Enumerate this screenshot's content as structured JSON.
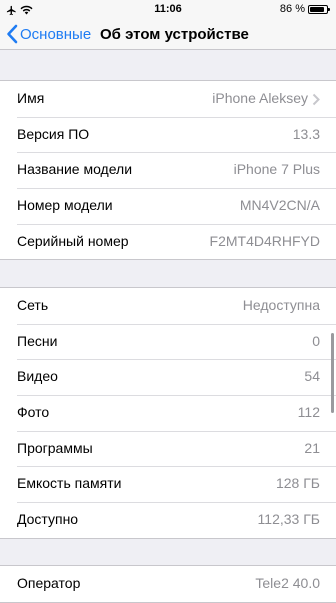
{
  "status_bar": {
    "time": "11:06",
    "battery_text": "86 %",
    "battery_level": 0.86
  },
  "nav": {
    "back_label": "Основные",
    "title": "Об этом устройстве"
  },
  "group1": [
    {
      "label": "Имя",
      "value": "iPhone Aleksey",
      "chevron": true
    },
    {
      "label": "Версия ПО",
      "value": "13.3"
    },
    {
      "label": "Название модели",
      "value": "iPhone 7 Plus"
    },
    {
      "label": "Номер модели",
      "value": "MN4V2CN/A"
    },
    {
      "label": "Серийный номер",
      "value": "F2MT4D4RHFYD"
    }
  ],
  "group2": [
    {
      "label": "Сеть",
      "value": "Недоступна"
    },
    {
      "label": "Песни",
      "value": "0"
    },
    {
      "label": "Видео",
      "value": "54"
    },
    {
      "label": "Фото",
      "value": "112"
    },
    {
      "label": "Программы",
      "value": "21"
    },
    {
      "label": "Емкость памяти",
      "value": "128 ГБ"
    },
    {
      "label": "Доступно",
      "value": "112,33 ГБ"
    }
  ],
  "group3": [
    {
      "label": "Оператор",
      "value": "Tele2 40.0"
    }
  ],
  "colors": {
    "accent": "#1f7cf3",
    "background": "#efeff4",
    "value_text": "#8e8e93"
  }
}
